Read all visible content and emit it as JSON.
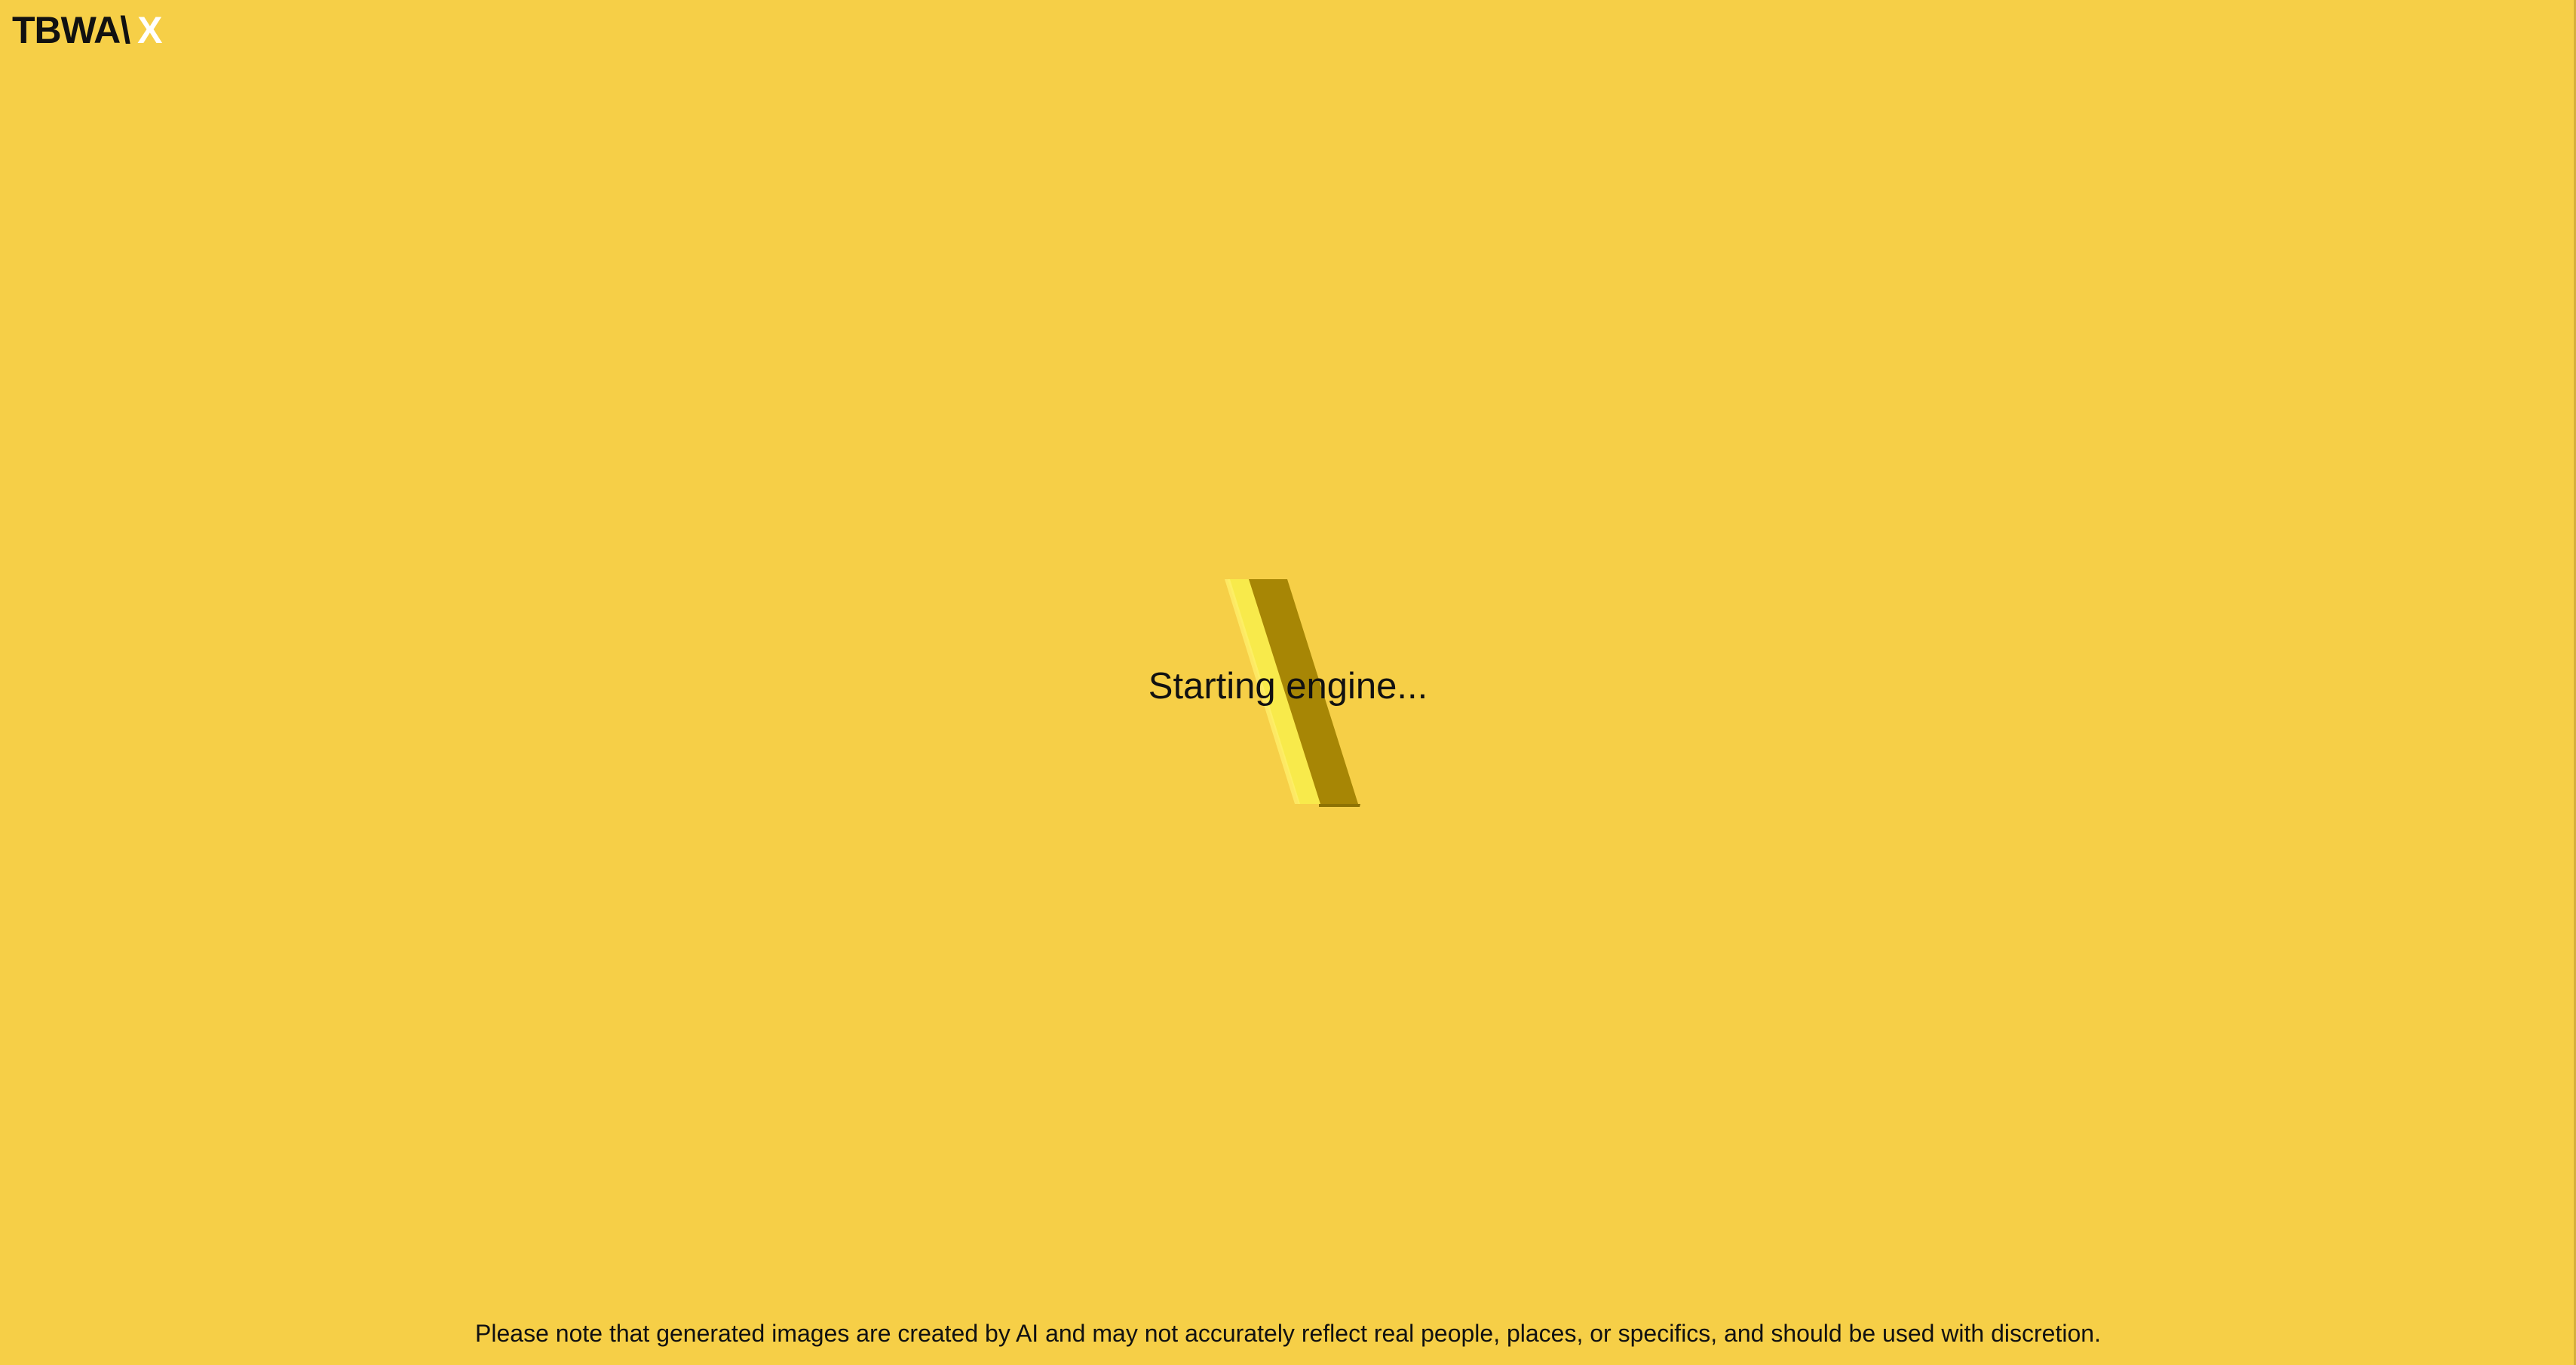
{
  "brand": {
    "logo_text": "TBWA\\",
    "logo_x": "X",
    "logo_mark_color": "#111111",
    "logo_x_color": "#ffffff"
  },
  "loading": {
    "status_text": "Starting engine...",
    "icon": "rotating-slash-loader-icon"
  },
  "footer": {
    "disclaimer": "Please note that generated images are created by AI and may not accurately reflect real people, places, or specifics, and should be used with discretion."
  },
  "theme": {
    "background": "#f6cf47",
    "loader_light": "#f8ea4b",
    "loader_dark": "#a78605"
  }
}
